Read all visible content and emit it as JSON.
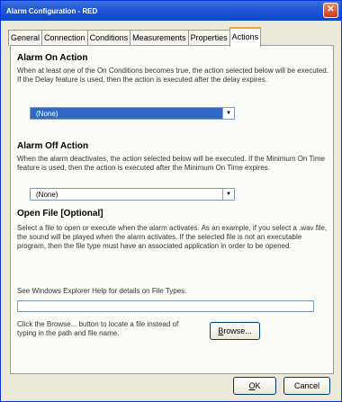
{
  "window": {
    "title": "Alarm Configuration - RED",
    "close_symbol": "✕"
  },
  "tabs": [
    {
      "label": "General"
    },
    {
      "label": "Connection"
    },
    {
      "label": "Conditions"
    },
    {
      "label": "Measurements"
    },
    {
      "label": "Properties"
    },
    {
      "label": "Actions"
    }
  ],
  "alarm_on": {
    "title": "Alarm On Action",
    "description": "When at least one of the On Conditions becomes true, the action selected below will be executed.  If the Delay feature is used, then the action is executed after the delay expires.",
    "selected": "(None)"
  },
  "alarm_off": {
    "title": "Alarm Off Action",
    "description": "When the alarm deactivates, the action selected below will be executed. If the Minimum On Time feature is used, then the action is executed after the Minimum On Time expires.",
    "selected": "(None)"
  },
  "open_file": {
    "title": "Open File  [Optional]",
    "description": "Select a file to open or execute when the alarm activates.  As an example, if you select a .wav file, the sound will be played when the alarm activates. If the selected file is not an executable program, then the file type must have an associated application in order to be opened.",
    "help_text": "See Windows Explorer Help for details on File Types.",
    "path_value": "",
    "browse_hint": "Click the Browse... button to locate a file instead of typing in the path and file name.",
    "browse_label": "Browse..."
  },
  "footer": {
    "ok_label": "OK",
    "cancel_label": "Cancel"
  },
  "icons": {
    "dropdown_arrow": "▼"
  },
  "colors": {
    "title_bar": "#0a47c8",
    "selection_highlight": "#316ac5",
    "active_tab_accent": "#f2a33a"
  }
}
